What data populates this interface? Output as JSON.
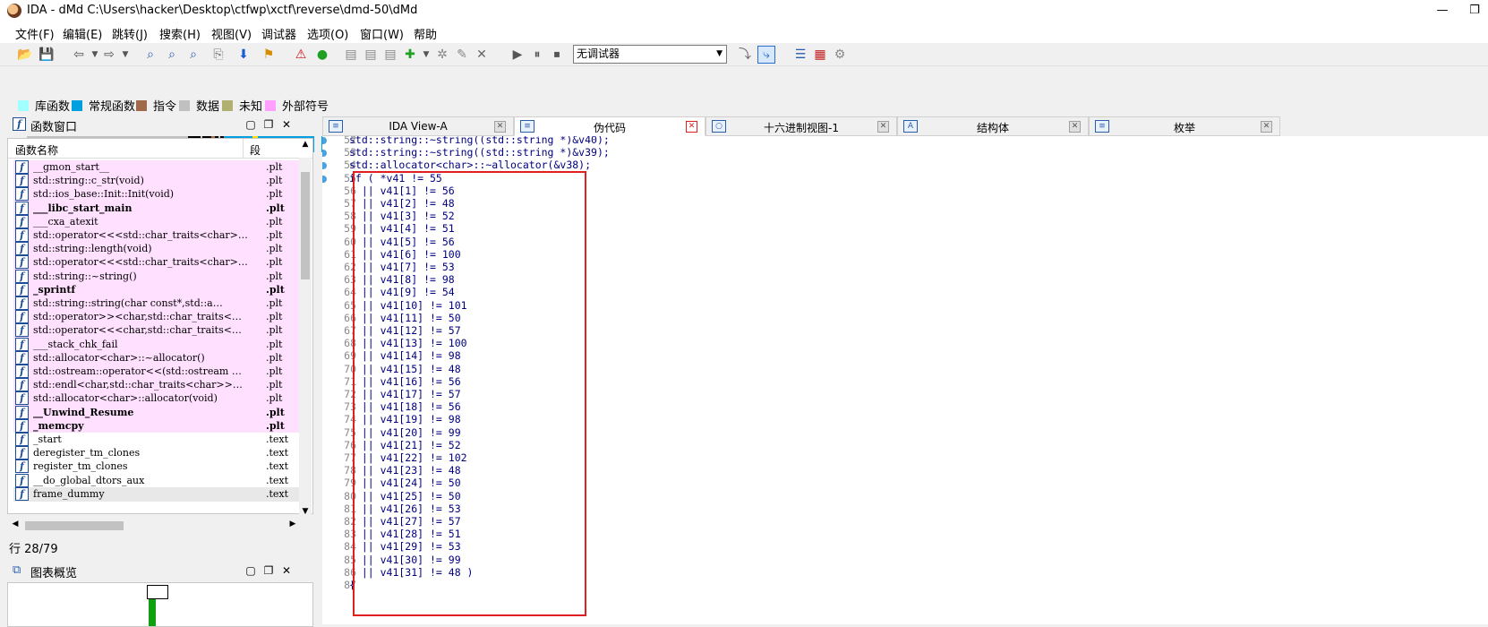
{
  "window": {
    "title": "IDA - dMd C:\\Users\\hacker\\Desktop\\ctfwp\\xctf\\reverse\\dmd-50\\dMd",
    "minimize": "—",
    "maximize": "❐"
  },
  "menu": [
    "文件(F)",
    "编辑(E)",
    "跳转(J)",
    "搜索(H)",
    "视图(V)",
    "调试器",
    "选项(O)",
    "窗口(W)",
    "帮助"
  ],
  "toolbar": {
    "debugger_select": "无调试器"
  },
  "legend": [
    {
      "label": "库函数",
      "color": "#a0ffff"
    },
    {
      "label": "常规函数",
      "color": "#00a0e0"
    },
    {
      "label": "指令",
      "color": "#a06a4a"
    },
    {
      "label": "数据",
      "color": "#c0c0c0"
    },
    {
      "label": "未知",
      "color": "#b0b070"
    },
    {
      "label": "外部符号",
      "color": "#ffa0ff"
    }
  ],
  "functions_panel": {
    "title": "函数窗口",
    "col_name": "函数名称",
    "col_segment": "段",
    "rows": [
      {
        "name": "__gmon_start__",
        "seg": ".plt",
        "bold": false,
        "pink": true
      },
      {
        "name": "std::string::c_str(void)",
        "seg": ".plt",
        "bold": false,
        "pink": true
      },
      {
        "name": "std::ios_base::Init::Init(void)",
        "seg": ".plt",
        "bold": false,
        "pink": true
      },
      {
        "name": "___libc_start_main",
        "seg": ".plt",
        "bold": true,
        "pink": true
      },
      {
        "name": "___cxa_atexit",
        "seg": ".plt",
        "bold": false,
        "pink": true
      },
      {
        "name": "std::operator<<<std::char_traits<char>…",
        "seg": ".plt",
        "bold": false,
        "pink": true
      },
      {
        "name": "std::string::length(void)",
        "seg": ".plt",
        "bold": false,
        "pink": true
      },
      {
        "name": "std::operator<<<std::char_traits<char>…",
        "seg": ".plt",
        "bold": false,
        "pink": true
      },
      {
        "name": "std::string::~string()",
        "seg": ".plt",
        "bold": false,
        "pink": true
      },
      {
        "name": "_sprintf",
        "seg": ".plt",
        "bold": true,
        "pink": true
      },
      {
        "name": "std::string::string(char const*,std::a…",
        "seg": ".plt",
        "bold": false,
        "pink": true
      },
      {
        "name": "std::operator>><char,std::char_traits<…",
        "seg": ".plt",
        "bold": false,
        "pink": true
      },
      {
        "name": "std::operator<<<char,std::char_traits<…",
        "seg": ".plt",
        "bold": false,
        "pink": true
      },
      {
        "name": "___stack_chk_fail",
        "seg": ".plt",
        "bold": false,
        "pink": true
      },
      {
        "name": "std::allocator<char>::~allocator()",
        "seg": ".plt",
        "bold": false,
        "pink": true
      },
      {
        "name": "std::ostream::operator<<(std::ostream …",
        "seg": ".plt",
        "bold": false,
        "pink": true
      },
      {
        "name": "std::endl<char,std::char_traits<char>>…",
        "seg": ".plt",
        "bold": false,
        "pink": true
      },
      {
        "name": "std::allocator<char>::allocator(void)",
        "seg": ".plt",
        "bold": false,
        "pink": true
      },
      {
        "name": "__Unwind_Resume",
        "seg": ".plt",
        "bold": true,
        "pink": true
      },
      {
        "name": "_memcpy",
        "seg": ".plt",
        "bold": true,
        "pink": true
      },
      {
        "name": "_start",
        "seg": ".text",
        "bold": false,
        "pink": false
      },
      {
        "name": "deregister_tm_clones",
        "seg": ".text",
        "bold": false,
        "pink": false
      },
      {
        "name": "register_tm_clones",
        "seg": ".text",
        "bold": false,
        "pink": false
      },
      {
        "name": "__do_global_dtors_aux",
        "seg": ".text",
        "bold": false,
        "pink": false
      },
      {
        "name": "frame_dummy",
        "seg": ".text",
        "bold": false,
        "pink": false,
        "selected": true
      }
    ],
    "status": "行 28/79"
  },
  "graph_panel": {
    "title": "图表概览"
  },
  "tabs": [
    {
      "label": "IDA View-A",
      "icon": "disasm-icon",
      "active": false
    },
    {
      "label": "伪代码",
      "icon": "pseudocode-icon",
      "active": true
    },
    {
      "label": "十六进制视图-1",
      "icon": "hex-icon",
      "active": false
    },
    {
      "label": "结构体",
      "icon": "struct-icon",
      "active": false
    },
    {
      "label": "枚举",
      "icon": "enum-icon",
      "active": false
    }
  ],
  "code_lines": [
    {
      "n": "52",
      "dot": true,
      "text": "std::string::~string((std::string *)&v40);"
    },
    {
      "n": "53",
      "dot": true,
      "text": "std::string::~string((std::string *)&v39);"
    },
    {
      "n": "54",
      "dot": true,
      "text": "std::allocator<char>::~allocator(&v38);"
    },
    {
      "n": "55",
      "dot": true,
      "text": "if ( *v41 != 55"
    },
    {
      "n": "56",
      "dot": false,
      "text": "  || v41[1] != 56"
    },
    {
      "n": "57",
      "dot": false,
      "text": "  || v41[2] != 48"
    },
    {
      "n": "58",
      "dot": false,
      "text": "  || v41[3] != 52"
    },
    {
      "n": "59",
      "dot": false,
      "text": "  || v41[4] != 51"
    },
    {
      "n": "60",
      "dot": false,
      "text": "  || v41[5] != 56"
    },
    {
      "n": "61",
      "dot": false,
      "text": "  || v41[6] != 100"
    },
    {
      "n": "62",
      "dot": false,
      "text": "  || v41[7] != 53"
    },
    {
      "n": "63",
      "dot": false,
      "text": "  || v41[8] != 98"
    },
    {
      "n": "64",
      "dot": false,
      "text": "  || v41[9] != 54"
    },
    {
      "n": "65",
      "dot": false,
      "text": "  || v41[10] != 101"
    },
    {
      "n": "66",
      "dot": false,
      "text": "  || v41[11] != 50"
    },
    {
      "n": "67",
      "dot": false,
      "text": "  || v41[12] != 57"
    },
    {
      "n": "68",
      "dot": false,
      "text": "  || v41[13] != 100"
    },
    {
      "n": "69",
      "dot": false,
      "text": "  || v41[14] != 98"
    },
    {
      "n": "70",
      "dot": false,
      "text": "  || v41[15] != 48"
    },
    {
      "n": "71",
      "dot": false,
      "text": "  || v41[16] != 56"
    },
    {
      "n": "72",
      "dot": false,
      "text": "  || v41[17] != 57"
    },
    {
      "n": "73",
      "dot": false,
      "text": "  || v41[18] != 56"
    },
    {
      "n": "74",
      "dot": false,
      "text": "  || v41[19] != 98"
    },
    {
      "n": "75",
      "dot": false,
      "text": "  || v41[20] != 99"
    },
    {
      "n": "76",
      "dot": false,
      "text": "  || v41[21] != 52"
    },
    {
      "n": "77",
      "dot": false,
      "text": "  || v41[22] != 102"
    },
    {
      "n": "78",
      "dot": false,
      "text": "  || v41[23] != 48"
    },
    {
      "n": "79",
      "dot": false,
      "text": "  || v41[24] != 50"
    },
    {
      "n": "80",
      "dot": false,
      "text": "  || v41[25] != 50"
    },
    {
      "n": "81",
      "dot": false,
      "text": "  || v41[26] != 53"
    },
    {
      "n": "82",
      "dot": false,
      "text": "  || v41[27] != 57"
    },
    {
      "n": "83",
      "dot": false,
      "text": "  || v41[28] != 51"
    },
    {
      "n": "84",
      "dot": false,
      "text": "  || v41[29] != 53"
    },
    {
      "n": "85",
      "dot": false,
      "text": "  || v41[30] != 99"
    },
    {
      "n": "86",
      "dot": false,
      "text": "  || v41[31] != 48 )"
    },
    {
      "n": "87",
      "dot": false,
      "text": "{"
    }
  ]
}
